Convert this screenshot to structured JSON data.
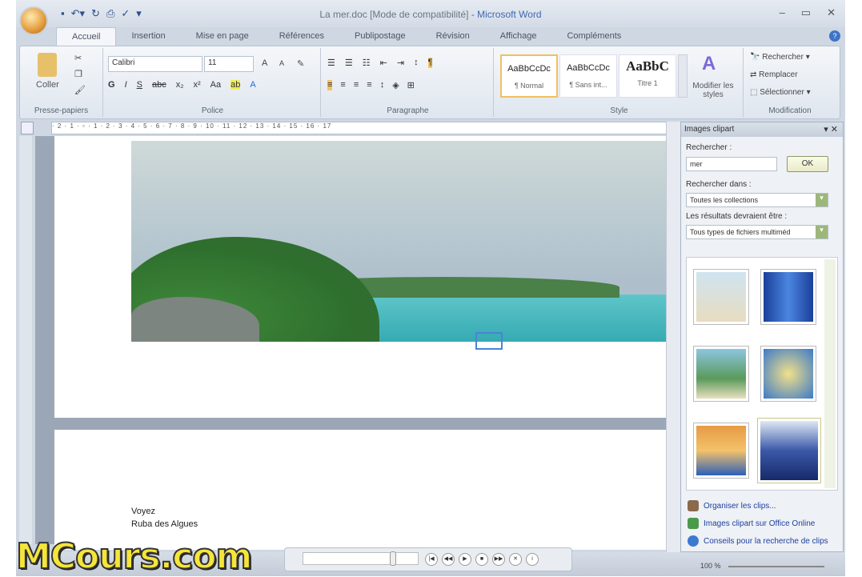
{
  "window": {
    "title": "La mer.doc [Mode de compatibilité]",
    "app": " - Microsoft Word"
  },
  "tabs": [
    "Accueil",
    "Insertion",
    "Mise en page",
    "Références",
    "Publipostage",
    "Révision",
    "Affichage",
    "Compléments"
  ],
  "ribbon": {
    "clipboard": {
      "paste": "Coller",
      "label": "Presse-papiers"
    },
    "font": {
      "name": "Calibri",
      "size": "11",
      "label": "Police"
    },
    "paragraph": {
      "label": "Paragraphe"
    },
    "styles": {
      "items": [
        {
          "sample": "AaBbCcDc",
          "name": "¶ Normal"
        },
        {
          "sample": "AaBbCcDc",
          "name": "¶ Sans int..."
        },
        {
          "sample": "AaBbC",
          "name": "Titre 1"
        }
      ],
      "change": "Modifier les styles",
      "label": "Style"
    },
    "editing": {
      "find": "Rechercher",
      "replace": "Remplacer",
      "select": "Sélectionner",
      "label": "Modification"
    }
  },
  "ruler": "· 2 · 1 · ▫ · 1 · 2 · 3 · 4 · 5 · 6 · 7 · 8 · 9 · 10 · 11 · 12 · 13 · 14 · 15 · 16 · 17",
  "document": {
    "lines": [
      "Voyez",
      "Ruba des Algues"
    ]
  },
  "clipart_pane": {
    "title": "Images clipart",
    "search_label": "Rechercher :",
    "search_value": "mer",
    "ok": "OK",
    "search_in_label": "Rechercher dans :",
    "search_in_value": "Toutes les collections",
    "results_label": "Les résultats devraient être :",
    "results_value": "Tous types de fichiers multiméd",
    "thumbs": [
      "beach",
      "blue-abstract",
      "palm-beach",
      "vacation",
      "house-sunset",
      "seascape"
    ],
    "links": [
      "Organiser les clips...",
      "Images clipart sur Office Online",
      "Conseils pour la recherche de clips"
    ]
  },
  "status": {
    "zoom": "100 %"
  },
  "watermark": "MCours.com",
  "colors": {
    "accent": "#3e6ab0",
    "selection": "#4a84d6"
  }
}
